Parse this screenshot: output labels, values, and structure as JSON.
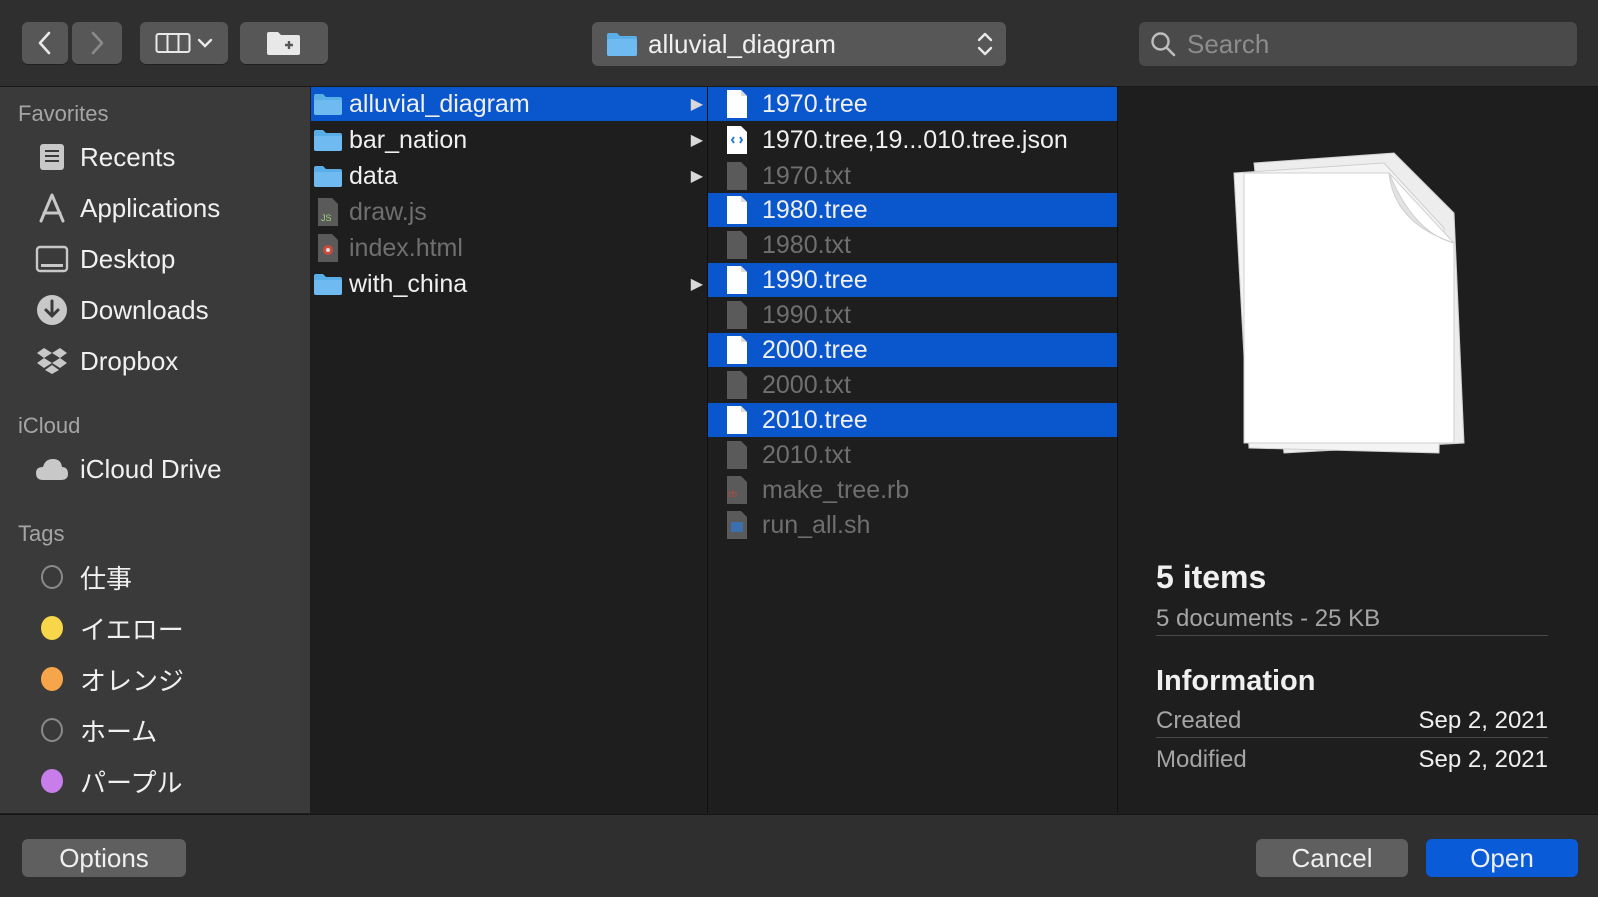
{
  "toolbar": {
    "back_icon": "chevron-left-icon",
    "forward_icon": "chevron-right-icon",
    "view_icon": "column-view-icon",
    "new_folder_icon": "new-folder-icon",
    "path_label": "alluvial_diagram",
    "search_placeholder": "Search"
  },
  "sidebar": {
    "favorites_header": "Favorites",
    "favorites": [
      {
        "label": "Recents",
        "icon": "recents-icon"
      },
      {
        "label": "Applications",
        "icon": "applications-icon"
      },
      {
        "label": "Desktop",
        "icon": "desktop-icon"
      },
      {
        "label": "Downloads",
        "icon": "downloads-icon"
      },
      {
        "label": "Dropbox",
        "icon": "dropbox-icon"
      }
    ],
    "icloud_header": "iCloud",
    "icloud": [
      {
        "label": "iCloud Drive",
        "icon": "cloud-icon"
      }
    ],
    "tags_header": "Tags",
    "tags": [
      {
        "label": "仕事",
        "color": "none"
      },
      {
        "label": "イエロー",
        "color": "#f7d64a"
      },
      {
        "label": "オレンジ",
        "color": "#f7a54a"
      },
      {
        "label": "ホーム",
        "color": "none"
      },
      {
        "label": "パープル",
        "color": "#c77dea"
      }
    ]
  },
  "column1": [
    {
      "name": "alluvial_diagram",
      "kind": "folder",
      "selected": true,
      "dim": false
    },
    {
      "name": "bar_nation",
      "kind": "folder",
      "selected": false,
      "dim": false
    },
    {
      "name": "data",
      "kind": "folder",
      "selected": false,
      "dim": false
    },
    {
      "name": "draw.js",
      "kind": "js",
      "selected": false,
      "dim": true
    },
    {
      "name": "index.html",
      "kind": "html",
      "selected": false,
      "dim": true
    },
    {
      "name": "with_china",
      "kind": "folder",
      "selected": false,
      "dim": false
    }
  ],
  "column2": [
    {
      "name": "1970.tree",
      "kind": "doc",
      "selected": true,
      "dim": false
    },
    {
      "name": "1970.tree,19...010.tree.json",
      "kind": "json",
      "selected": false,
      "dim": false
    },
    {
      "name": "1970.txt",
      "kind": "txt",
      "selected": false,
      "dim": true
    },
    {
      "name": "1980.tree",
      "kind": "doc",
      "selected": true,
      "dim": false
    },
    {
      "name": "1980.txt",
      "kind": "txt",
      "selected": false,
      "dim": true
    },
    {
      "name": "1990.tree",
      "kind": "doc",
      "selected": true,
      "dim": false
    },
    {
      "name": "1990.txt",
      "kind": "txt",
      "selected": false,
      "dim": true
    },
    {
      "name": "2000.tree",
      "kind": "doc",
      "selected": true,
      "dim": false
    },
    {
      "name": "2000.txt",
      "kind": "txt",
      "selected": false,
      "dim": true
    },
    {
      "name": "2010.tree",
      "kind": "doc",
      "selected": true,
      "dim": false
    },
    {
      "name": "2010.txt",
      "kind": "txt",
      "selected": false,
      "dim": true
    },
    {
      "name": "make_tree.rb",
      "kind": "rb",
      "selected": false,
      "dim": true
    },
    {
      "name": "run_all.sh",
      "kind": "sh",
      "selected": false,
      "dim": true
    }
  ],
  "preview": {
    "title": "5 items",
    "subtitle": "5 documents - 25 KB",
    "info_header": "Information",
    "created_label": "Created",
    "created_value": "Sep 2, 2021",
    "modified_label": "Modified",
    "modified_value": "Sep 2, 2021"
  },
  "buttons": {
    "options": "Options",
    "cancel": "Cancel",
    "open": "Open"
  },
  "colors": {
    "selection": "#0a57cd",
    "primary_button": "#0a5bd8",
    "folder": "#5aaee8"
  }
}
